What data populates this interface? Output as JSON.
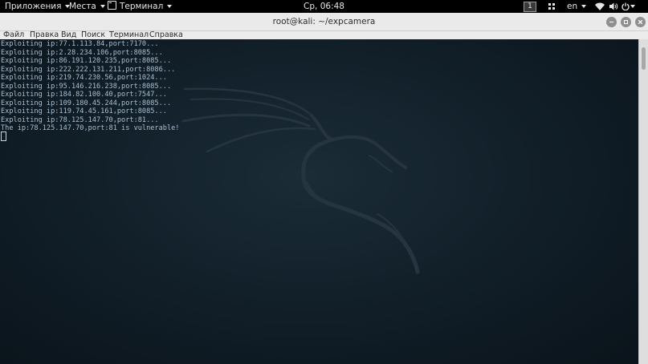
{
  "top_panel": {
    "apps_menu": "Приложения",
    "places_menu": "Места",
    "terminal_app_menu": "Терминал",
    "clock": "Ср, 06:48",
    "workspace": "1",
    "keyboard_layout": "en",
    "icons": [
      "apps-grid-icon",
      "wifi-icon",
      "volume-icon",
      "power-icon"
    ]
  },
  "window": {
    "title": "root@kali: ~/expcamera",
    "buttons": [
      "minimize",
      "maximize",
      "close"
    ]
  },
  "menubar": {
    "items": [
      "Файл",
      "Правка",
      "Вид",
      "Поиск",
      "Терминал",
      "Справка"
    ]
  },
  "terminal": {
    "lines": [
      "Exploiting ip:77.1.113.84,port:7170...",
      "Exploiting ip:2.28.234.106,port:8085...",
      "Exploiting ip:86.191.120.235,port:8085...",
      "Exploiting ip:222.222.131.211,port:8086...",
      "Exploiting ip:219.74.230.56,port:1024...",
      "Exploiting ip:95.146.216.238,port:8085...",
      "Exploiting ip:184.82.100.40,port:7547...",
      "Exploiting ip:109.180.45.244,port:8085...",
      "Exploiting ip:119.74.45.161,port:8085...",
      "Exploiting ip:78.125.147.70,port:81...",
      "The ip:78.125.147.70,port:81 is vulnerable!"
    ],
    "colors": {
      "text": "#a9bfd1",
      "background": "#12202a",
      "watermark": "#26343f"
    }
  }
}
